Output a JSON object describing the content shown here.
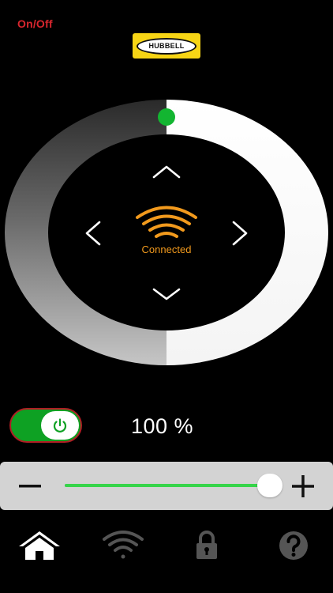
{
  "header": {
    "onoff_label": "On/Off",
    "logo_text": "HUBBELL"
  },
  "dial": {
    "status_text": "Connected",
    "level": 0.5,
    "colors": {
      "indicator": "#13b531",
      "wifi": "#f29a1d"
    },
    "icons": [
      "chevron-up-icon",
      "chevron-down-icon",
      "chevron-left-icon",
      "chevron-right-icon",
      "wifi-icon"
    ]
  },
  "power": {
    "state": "on",
    "percent_text": "100 %",
    "colors": {
      "on": "#0ea123",
      "border": "#b01e24"
    }
  },
  "slider": {
    "value": 1.0,
    "minus_icon": "minus-icon",
    "plus_icon": "plus-icon",
    "colors": {
      "fill": "#36d44a"
    }
  },
  "nav": {
    "items": [
      {
        "icon": "home-icon",
        "active": true
      },
      {
        "icon": "wifi-icon",
        "active": false
      },
      {
        "icon": "lock-icon",
        "active": false
      },
      {
        "icon": "help-icon",
        "active": false
      }
    ]
  }
}
